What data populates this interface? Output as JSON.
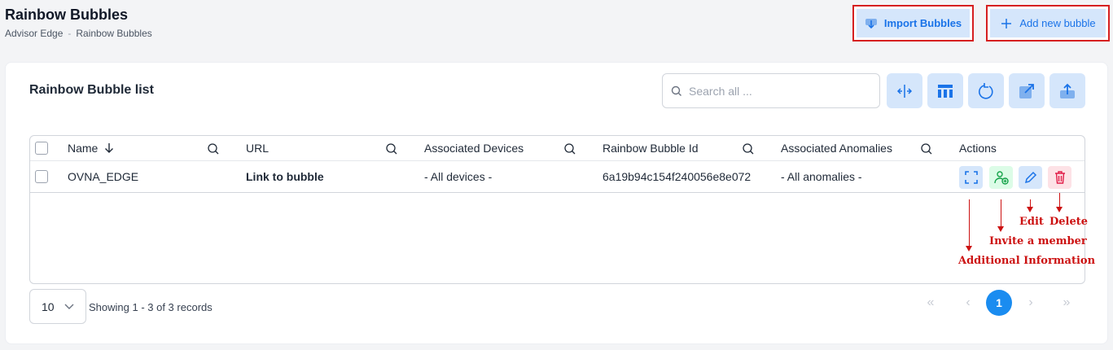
{
  "header": {
    "title": "Rainbow Bubbles",
    "breadcrumb": [
      "Advisor Edge",
      "Rainbow Bubbles"
    ],
    "breadcrumb_sep": "-",
    "import_label": "Import Bubbles",
    "add_label": "Add new bubble"
  },
  "card": {
    "title": "Rainbow Bubble list",
    "search_placeholder": "Search all ..."
  },
  "table": {
    "columns": [
      "Name",
      "URL",
      "Associated Devices",
      "Rainbow Bubble Id",
      "Associated Anomalies",
      "Actions"
    ],
    "rows": [
      {
        "name": "OVNA_EDGE",
        "url": "Link to bubble",
        "devices": "- All devices -",
        "bubble_id": "6a19b94c154f240056e8e072",
        "anomalies": "- All anomalies -"
      }
    ]
  },
  "annotations": {
    "edit": "Edit",
    "delete": "Delete",
    "invite": "Invite a member",
    "info": "Additional Information"
  },
  "pagination": {
    "per_page": "10",
    "records": "Showing 1 - 3 of 3 records",
    "current_page": "1"
  },
  "colors": {
    "accent": "#1a8cf0",
    "button_bg": "#d5e6fb",
    "annotation": "#cc1111",
    "delete": "#e11d48",
    "invite": "#16a34a"
  },
  "icons": [
    "download-icon",
    "plus-icon",
    "search-icon",
    "columns-resize-icon",
    "layout-icon",
    "refresh-icon",
    "external-link-icon",
    "upload-icon",
    "sort-down-icon",
    "expand-icon",
    "add-user-icon",
    "edit-icon",
    "trash-icon",
    "chevron-down-icon",
    "double-chevron-left-icon",
    "chevron-left-icon",
    "chevron-right-icon",
    "double-chevron-right-icon"
  ]
}
